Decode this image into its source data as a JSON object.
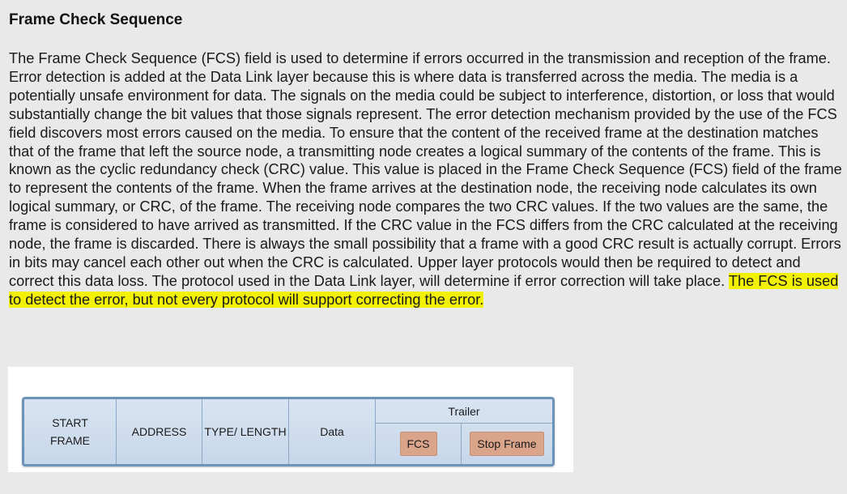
{
  "heading": "Frame Check Sequence",
  "paragraph": {
    "text": "The Frame Check Sequence (FCS) field is used to determine if errors occurred in the transmission and reception of the frame. Error detection is added at the Data Link layer because this is where data is transferred across the media. The media is a potentially unsafe environment for data. The signals on the media could be subject to interference, distortion, or loss that would substantially change the bit values that those signals represent. The error detection mechanism provided by the use of the FCS field discovers most errors caused on the media. To ensure that the content of the received frame at the destination matches that of the frame that left the source node, a transmitting node creates a logical summary of the contents of the frame. This is known as the cyclic redundancy check (CRC) value. This value is placed in the Frame Check Sequence (FCS) field of the frame to represent the contents of the frame. When the frame arrives at the destination node, the receiving node calculates its own logical summary, or CRC, of the frame. The receiving node compares the two CRC values. If the two values are the same, the frame is considered to have arrived as transmitted. If the CRC value in the FCS differs from the CRC calculated at the receiving node, the frame is discarded. There is always the small possibility that a frame with a good CRC result is actually corrupt. Errors in bits may cancel each other out when the CRC is calculated. Upper layer protocols would then be required to detect and correct this data loss. The protocol used in the Data Link layer, will determine if error correction will take place. ",
    "highlighted": "The FCS is used to detect the error, but not every protocol will support correcting the error."
  },
  "highlight_color": "#f2f200",
  "diagram": {
    "fields": [
      "START FRAME",
      "ADDRESS",
      "TYPE/ LENGTH",
      "Data"
    ],
    "trailer": {
      "label": "Trailer",
      "fields": [
        "FCS",
        "Stop Frame"
      ]
    }
  }
}
